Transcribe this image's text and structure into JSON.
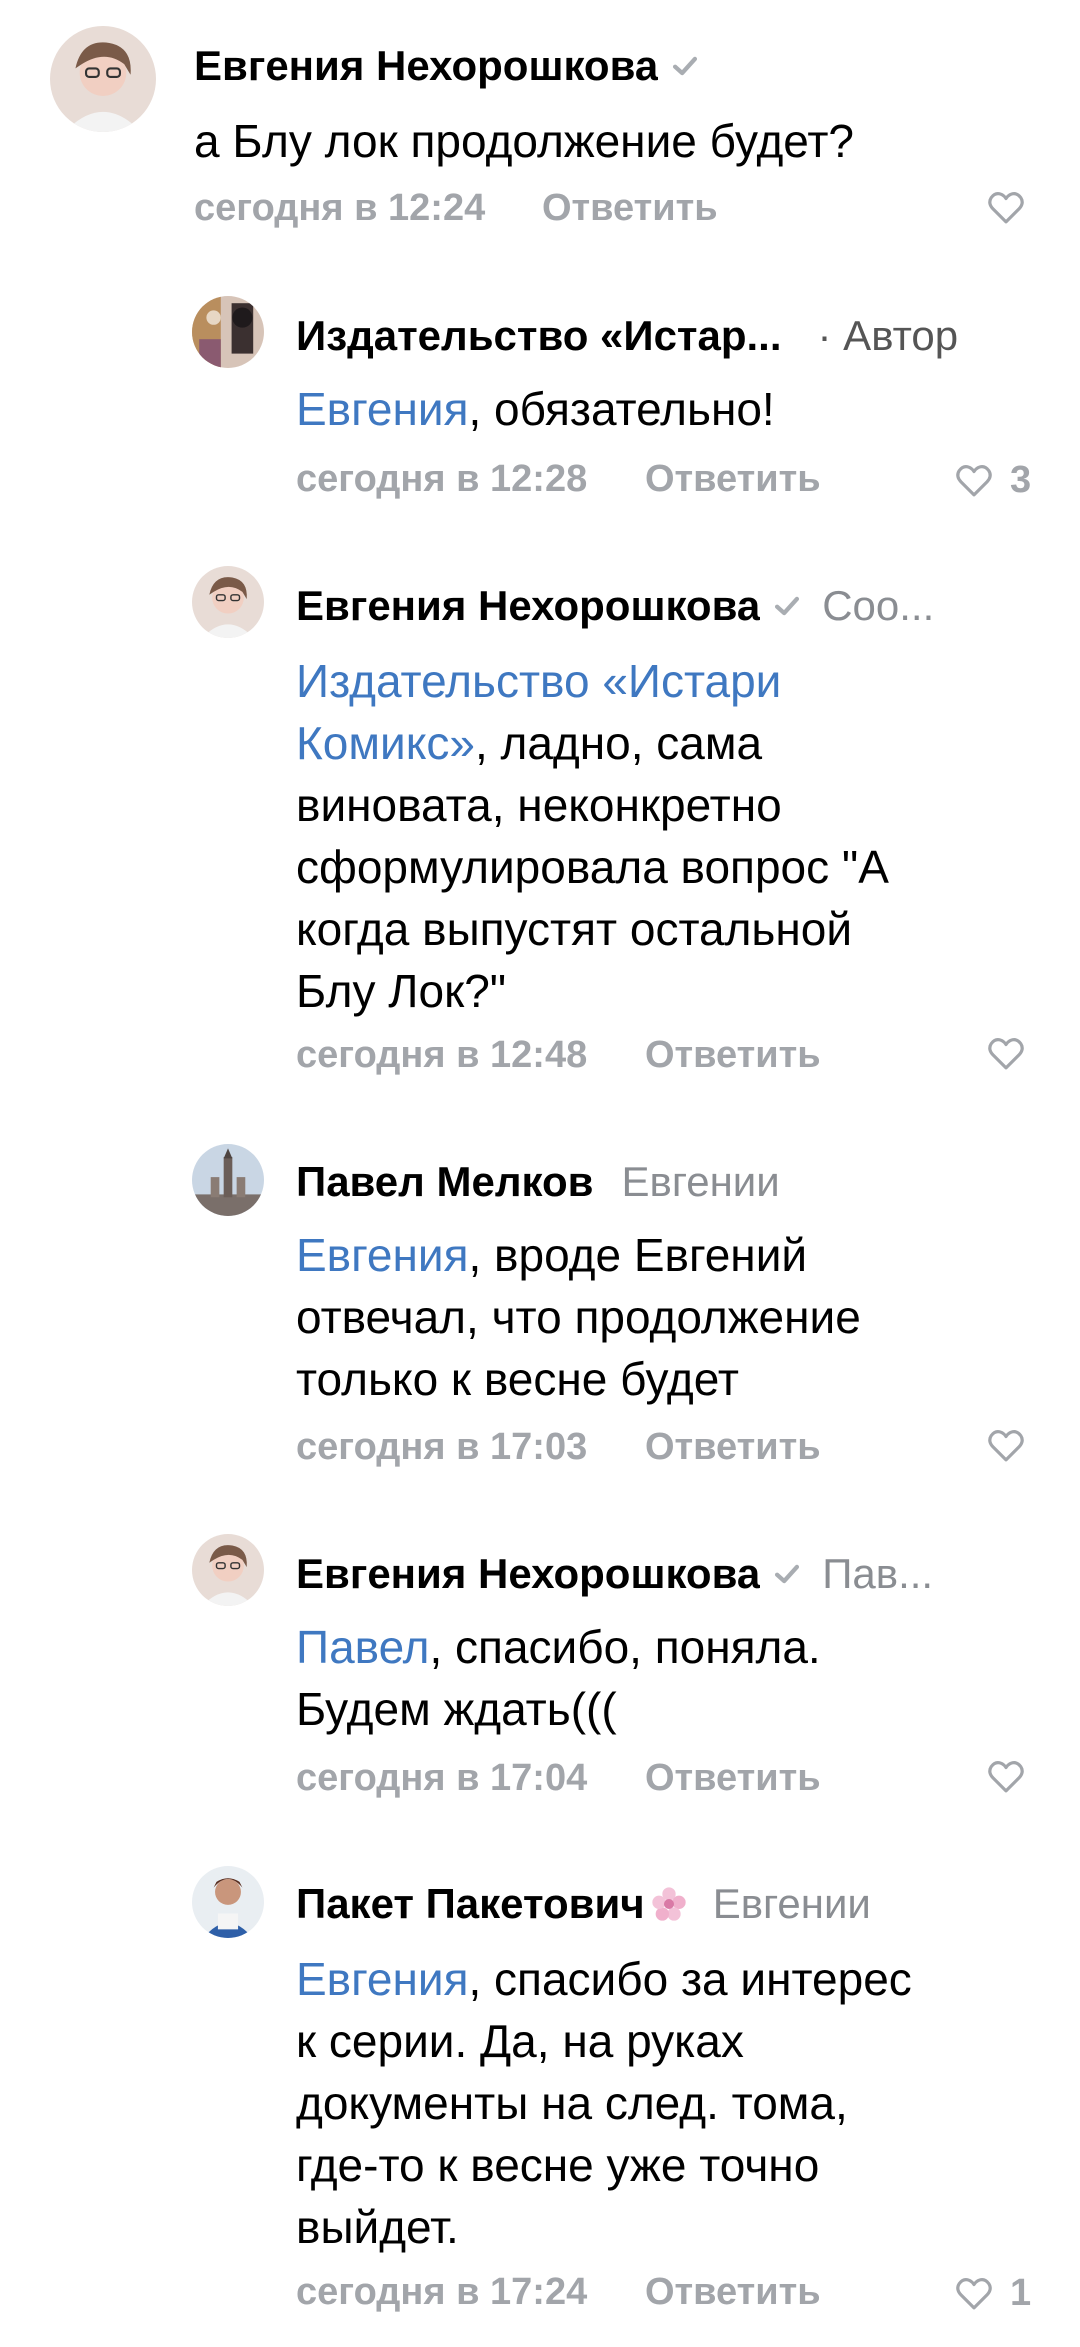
{
  "comments": [
    {
      "author": "Евгения Нехорошкова",
      "verified": true,
      "text": "а Блу лок продолжение будет?",
      "time": "сегодня в 12:24",
      "reply_label": "Ответить",
      "likes": ""
    },
    {
      "author": "Издательство «Истар...",
      "badge": "· Автор",
      "mention": "Евгения",
      "text": ", обязательно!",
      "time": "сегодня в 12:28",
      "reply_label": "Ответить",
      "likes": "3"
    },
    {
      "author": "Евгения Нехорошкова",
      "verified": true,
      "reply_to": "Соо...",
      "mention_line1": "Издательство «Истари",
      "mention_line2": "Комикс»",
      "text_line2": ", ладно, сама",
      "text_line3": "виновата, неконкретно",
      "text_line4": "сформулировала вопрос \"А",
      "text_line5": "когда выпустят остальной",
      "text_line6": "Блу Лок?\"",
      "time": "сегодня в 12:48",
      "reply_label": "Ответить",
      "likes": ""
    },
    {
      "author": "Павел Мелков",
      "reply_to": "Евгении",
      "mention": "Евгения",
      "text_line1": ", вроде Евгений",
      "text_line2": "отвечал, что продолжение",
      "text_line3": "только к весне будет",
      "time": "сегодня в 17:03",
      "reply_label": "Ответить",
      "likes": ""
    },
    {
      "author": "Евгения Нехорошкова",
      "verified": true,
      "reply_to": "Пав...",
      "mention": "Павел",
      "text_line1": ", спасибо, поняла.",
      "text_line2": "Будем ждать(((",
      "time": "сегодня в 17:04",
      "reply_label": "Ответить",
      "likes": ""
    },
    {
      "author": "Пакет Пакетович",
      "reply_to": "Евгении",
      "mention": "Евгения",
      "text_line1": ", спасибо за интерес",
      "text_line2": "к серии. Да, на руках",
      "text_line3": "документы на след. тома,",
      "text_line4": "где-то к весне уже точно",
      "text_line5": "выйдет.",
      "time": "сегодня в 17:24",
      "reply_label": "Ответить",
      "likes": "1"
    }
  ],
  "colors": {
    "mention": "#3f78c1",
    "meta": "#a2a5aa",
    "reply_to": "#8a8d92"
  },
  "icons": {
    "verified": "check-icon",
    "like": "heart-icon"
  }
}
